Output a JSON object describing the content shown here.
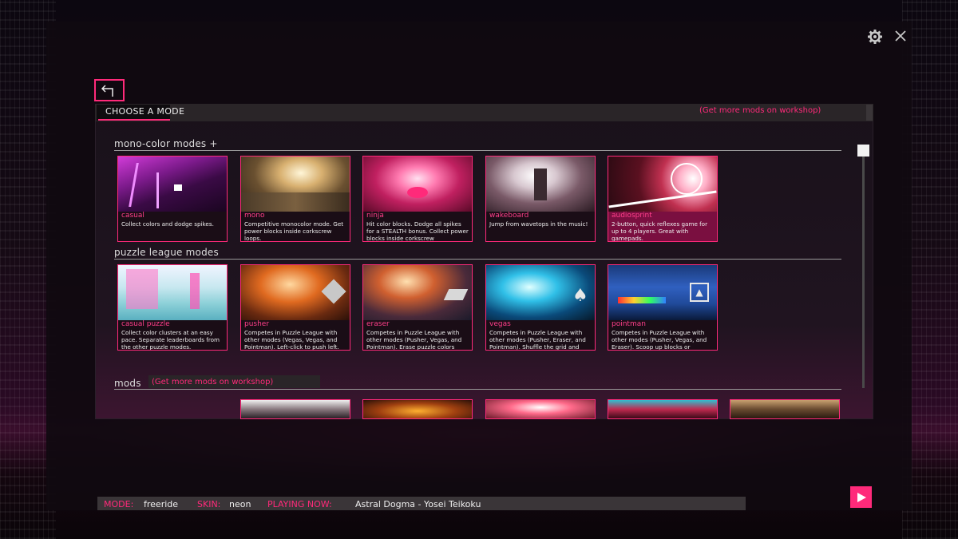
{
  "header": {
    "title": "CHOOSE A MODE",
    "workshop_link": "(Get more mods on workshop)"
  },
  "sections": {
    "mono": {
      "title": "mono-color modes +"
    },
    "puzzle": {
      "title": "puzzle league modes"
    },
    "mods": {
      "title": "mods",
      "workshop_link": "(Get more mods on workshop)"
    }
  },
  "mono_modes": [
    {
      "name": "casual",
      "desc": "Collect colors and dodge spikes."
    },
    {
      "name": "mono",
      "desc": "Competitive monocolor mode. Get power blocks inside corkscrew loops."
    },
    {
      "name": "ninja",
      "desc": "Hit color blocks. Dodge all spikes for a STEALTH bonus. Collect power blocks inside corkscrew"
    },
    {
      "name": "wakeboard",
      "desc": "Jump from wavetops in the music!"
    },
    {
      "name": "audiosprint",
      "desc": "2-button, quick reflexes game for up to 4 players. Great with gamepads."
    }
  ],
  "puzzle_modes": [
    {
      "name": "casual puzzle",
      "desc": "Collect color clusters at an easy pace. Separate leaderboards from the other puzzle modes."
    },
    {
      "name": "pusher",
      "desc": "Competes in Puzzle League with other modes (Vegas, Vegas, and Pointman). Left-click to push left."
    },
    {
      "name": "eraser",
      "desc": "Competes in Puzzle League with other modes (Pusher, Vegas, and Pointman). Erase puzzle colors"
    },
    {
      "name": "vegas",
      "desc": "Competes in Puzzle League with other modes (Pusher, Eraser, and Pointman). Shuffle the grid and"
    },
    {
      "name": "pointman",
      "desc": "Competes in Puzzle League with other modes (Pusher, Vegas, and Eraser). Scoop up blocks or"
    }
  ],
  "status": {
    "mode_label": "MODE:",
    "mode_value": "freeride",
    "skin_label": "SKIN:",
    "skin_value": "neon",
    "playing_label": "PLAYING NOW:",
    "playing_value": "Astral Dogma - Yosei Teikoku"
  },
  "icons": {
    "settings": "gear-icon",
    "close": "close-icon",
    "back": "back-arrow-icon",
    "play": "play-icon"
  },
  "colors": {
    "accent": "#ff2a7a",
    "selected_card": "#7a0f40"
  }
}
